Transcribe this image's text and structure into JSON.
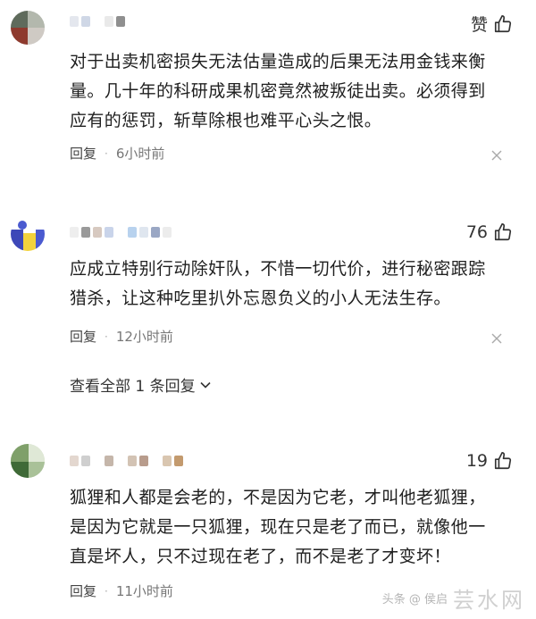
{
  "comments": [
    {
      "like_label": "赞",
      "text": "对于出卖机密损失无法估量造成的后果无法用金钱来衡\n量。几十年的科研成果机密竟然被叛徒出卖。必须得到\n应有的惩罚，斩草除根也难平心头之恨。",
      "reply_label": "回复",
      "dot": "·",
      "time": "6小时前"
    },
    {
      "like_label": "76",
      "text": "应成立特别行动除奸队，不惜一切代价，进行秘密跟踪\n猎杀，让这种吃里扒外忘恩负义的小人无法生存。",
      "reply_label": "回复",
      "dot": "·",
      "time": "12小时前",
      "view_replies": "查看全部 1 条回复"
    },
    {
      "like_label": "19",
      "text": "狐狸和人都是会老的，不是因为它老，才叫他老狐狸，\n是因为它就是一只狐狸，现在只是老了而已，就像他一\n直是坏人，只不过现在老了，而不是老了才变坏！",
      "reply_label": "回复",
      "dot": "·",
      "time": "11小时前"
    }
  ],
  "watermark": {
    "brand": "芸水网",
    "sub": "头条 @ 侯启"
  },
  "icons": {
    "like": "thumbs-up-icon",
    "close": "close-icon",
    "expand": "chevron-down-icon"
  },
  "colors": {
    "text": "#1f1f1f",
    "meta": "#777777"
  }
}
